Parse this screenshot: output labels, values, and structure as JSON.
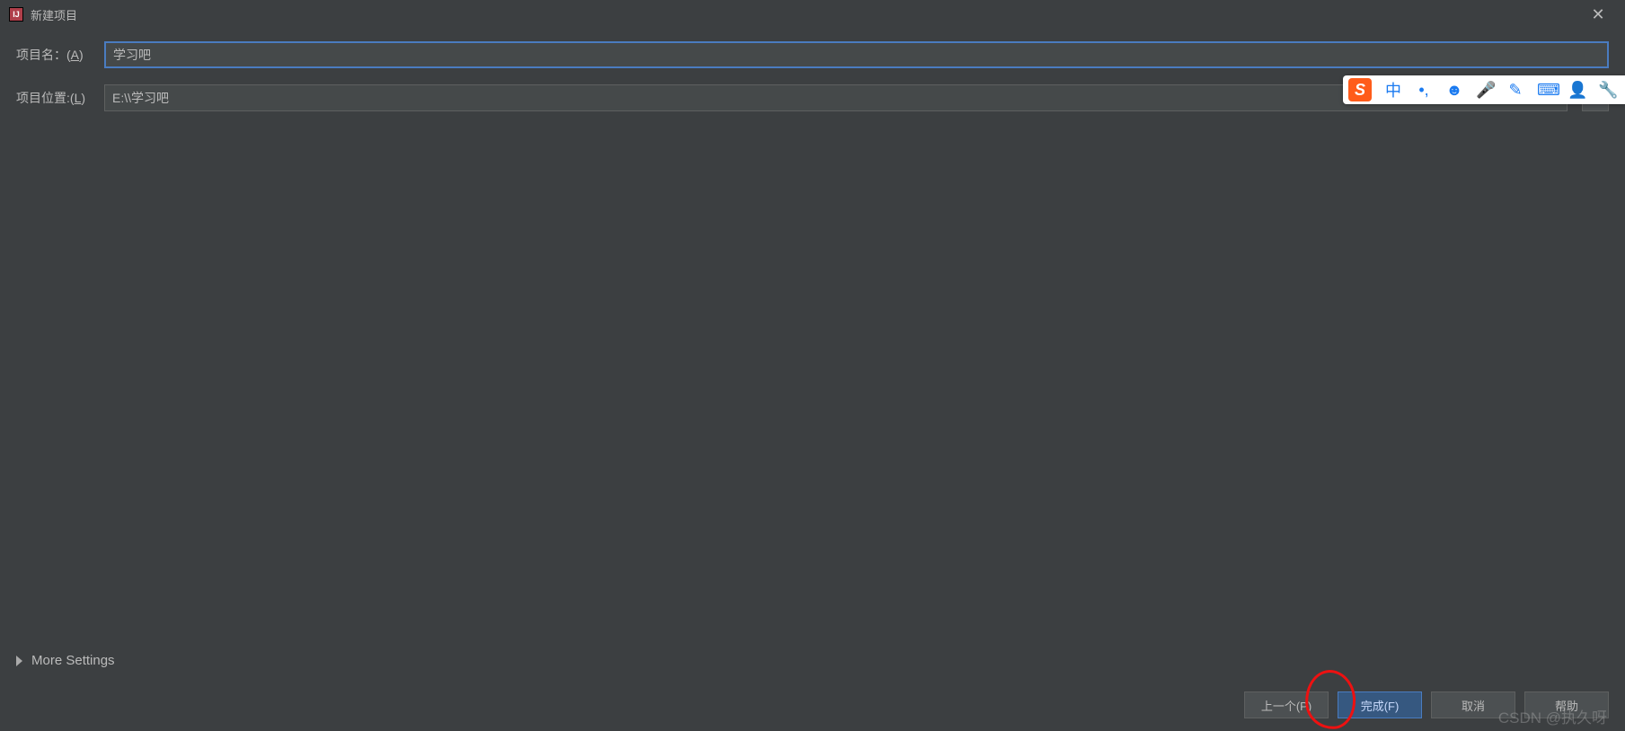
{
  "titlebar": {
    "app_icon_text": "IJ",
    "title": "新建项目",
    "close_icon": "✕"
  },
  "form": {
    "name_label_prefix": "项目名：(",
    "name_label_mnemonic": "A",
    "name_label_suffix": ")",
    "name_value": "学习吧",
    "location_label_prefix": "项目位置:(",
    "location_label_mnemonic": "L",
    "location_label_suffix": ")",
    "location_value": "E:\\\\学习吧",
    "browse_label": "…"
  },
  "more_settings": {
    "label": "More Settings"
  },
  "buttons": {
    "prev": "上一个(P)",
    "finish": "完成(F)",
    "cancel": "取消",
    "help": "帮助"
  },
  "ime": {
    "logo": "S",
    "items": [
      "中",
      "•,",
      "☻",
      "🎤",
      "✎",
      "⌨",
      "👤",
      "🔧"
    ]
  },
  "watermark": "CSDN @执久呀"
}
